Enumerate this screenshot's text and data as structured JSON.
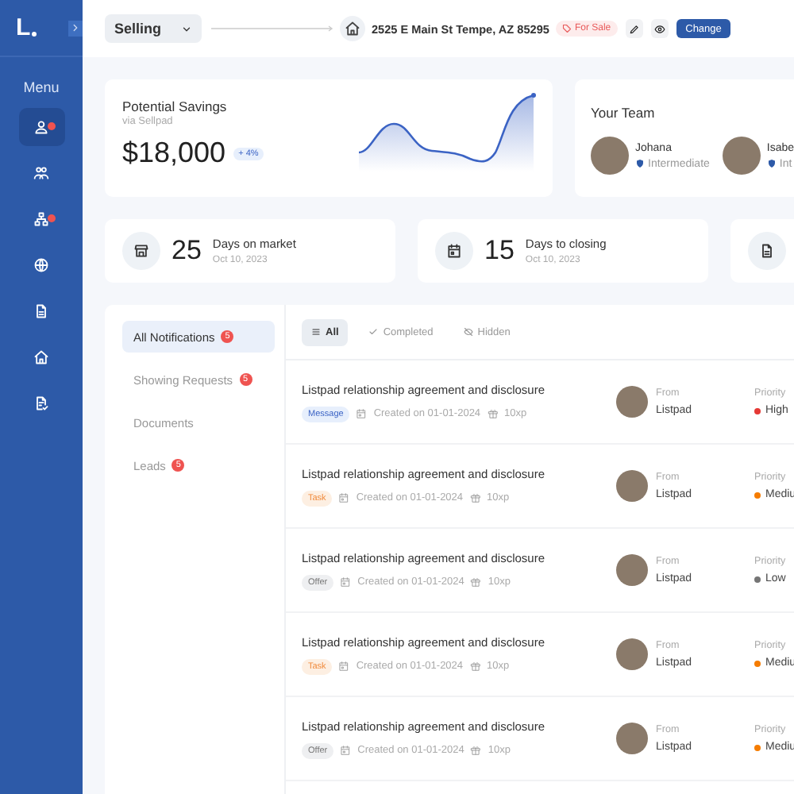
{
  "sidebar": {
    "logo": "L",
    "menu_label": "Menu",
    "items": [
      {
        "kind": "user",
        "selected": true,
        "badge": true
      },
      {
        "kind": "team",
        "selected": false,
        "badge": false
      },
      {
        "kind": "sitemap",
        "selected": false,
        "badge": true
      },
      {
        "kind": "globe",
        "selected": false,
        "badge": false
      },
      {
        "kind": "doc",
        "selected": false,
        "badge": false
      },
      {
        "kind": "home",
        "selected": false,
        "badge": false
      },
      {
        "kind": "doc-check",
        "selected": false,
        "badge": false
      }
    ]
  },
  "topbar": {
    "mode": "Selling",
    "address": "2525 E Main St Tempe, AZ 85295",
    "tag": "For Sale",
    "button": "Change"
  },
  "savings": {
    "title": "Potential Savings",
    "subtitle": "via Sellpad",
    "amount": "$18,000",
    "change": "+ 4%"
  },
  "team": {
    "title": "Your Team",
    "members": [
      {
        "name": "Johana",
        "rank": "Intermediate"
      },
      {
        "name": "Isabe",
        "rank": "Int"
      }
    ]
  },
  "stats": [
    {
      "kind": "store",
      "value": "25",
      "label": "Days on market",
      "date": "Oct 10, 2023"
    },
    {
      "kind": "calendar",
      "value": "15",
      "label": "Days to closing",
      "date": "Oct 10, 2023"
    },
    {
      "kind": "doc"
    }
  ],
  "categories": [
    {
      "label": "All Notifications",
      "count": "5",
      "selected": true
    },
    {
      "label": "Showing Requests",
      "count": "5",
      "selected": false
    },
    {
      "label": "Documents",
      "selected": false
    },
    {
      "label": "Leads",
      "count": "5",
      "selected": false
    }
  ],
  "filters": [
    {
      "kind": "list",
      "label": "All",
      "selected": true
    },
    {
      "kind": "check",
      "label": "Completed",
      "selected": false
    },
    {
      "kind": "eye-off",
      "label": "Hidden",
      "selected": false
    }
  ],
  "notifications": [
    {
      "title": "Listpad relationship agreement and disclosure",
      "kind": "message",
      "tag": "Message",
      "created": "Created on 01-01-2024",
      "xp": "10xp",
      "from_label": "From",
      "from": "Listpad",
      "priority_label": "Priority",
      "priority": "High",
      "color": "#e53935"
    },
    {
      "title": "Listpad relationship agreement and disclosure",
      "kind": "task",
      "tag": "Task",
      "created": "Created on 01-01-2024",
      "xp": "10xp",
      "from_label": "From",
      "from": "Listpad",
      "priority_label": "Priority",
      "priority": "Mediu",
      "color": "#f57c00"
    },
    {
      "title": "Listpad relationship agreement and disclosure",
      "kind": "offer",
      "tag": "Offer",
      "created": "Created on 01-01-2024",
      "xp": "10xp",
      "from_label": "From",
      "from": "Listpad",
      "priority_label": "Priority",
      "priority": "Low",
      "color": "#757575"
    },
    {
      "title": "Listpad relationship agreement and disclosure",
      "kind": "task",
      "tag": "Task",
      "created": "Created on 01-01-2024",
      "xp": "10xp",
      "from_label": "From",
      "from": "Listpad",
      "priority_label": "Priority",
      "priority": "Mediu",
      "color": "#f57c00"
    },
    {
      "title": "Listpad relationship agreement and disclosure",
      "kind": "offer",
      "tag": "Offer",
      "created": "Created on 01-01-2024",
      "xp": "10xp",
      "from_label": "From",
      "from": "Listpad",
      "priority_label": "Priority",
      "priority": "Mediu",
      "color": "#f57c00"
    }
  ]
}
